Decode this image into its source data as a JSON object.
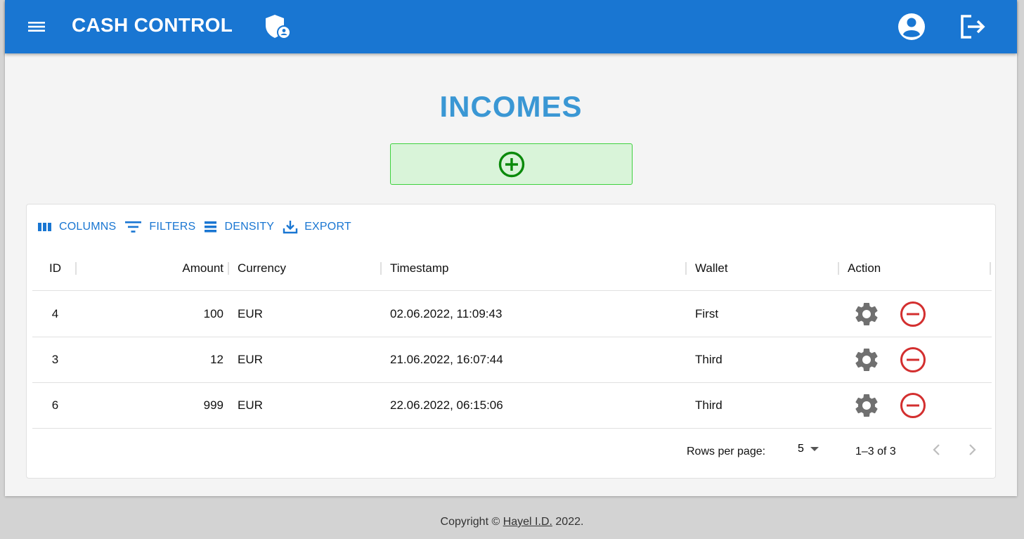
{
  "app": {
    "brand": "CASH CONTROL",
    "primary_color": "#1976d2"
  },
  "page": {
    "title": "INCOMES"
  },
  "toolbar": {
    "columns": "COLUMNS",
    "filters": "FILTERS",
    "density": "DENSITY",
    "export": "EXPORT"
  },
  "table": {
    "headers": {
      "id": "ID",
      "amount": "Amount",
      "currency": "Currency",
      "timestamp": "Timestamp",
      "wallet": "Wallet",
      "action": "Action"
    },
    "rows": [
      {
        "id": "4",
        "amount": "100",
        "currency": "EUR",
        "timestamp": "02.06.2022, 11:09:43",
        "wallet": "First"
      },
      {
        "id": "3",
        "amount": "12",
        "currency": "EUR",
        "timestamp": "21.06.2022, 16:07:44",
        "wallet": "Third"
      },
      {
        "id": "6",
        "amount": "999",
        "currency": "EUR",
        "timestamp": "22.06.2022, 06:15:06",
        "wallet": "Third"
      }
    ]
  },
  "pagination": {
    "rows_per_page_label": "Rows per page:",
    "rows_per_page_value": "5",
    "range": "1–3 of 3"
  },
  "footer": {
    "prefix": "Copyright ©",
    "author": "Hayel I.D.",
    "year": "2022."
  },
  "icons": {
    "menu": "menu-icon",
    "shield": "admin-shield-icon",
    "account": "account-circle-icon",
    "logout": "logout-icon",
    "add": "add-circle-icon",
    "settings": "gear-icon",
    "delete": "remove-circle-icon"
  }
}
